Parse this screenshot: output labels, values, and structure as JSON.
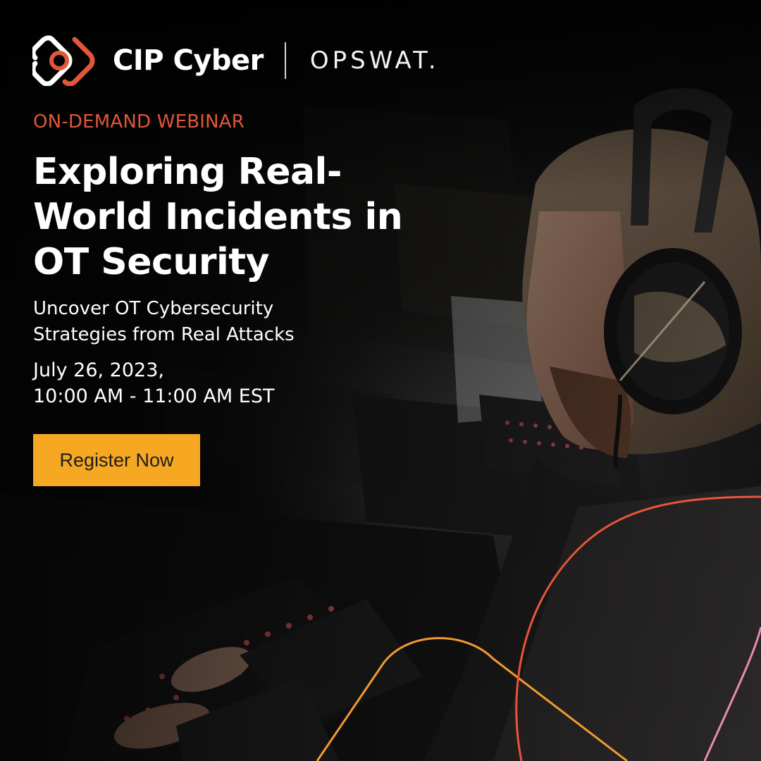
{
  "brand": {
    "primary_name": "CIP Cyber",
    "partner_name": "OPSWAT.",
    "logo_icon": "cip-cyber-logo-icon",
    "accent_color": "#e0573a",
    "logo_ring_color": "#e0573a"
  },
  "webinar": {
    "eyebrow": "ON-DEMAND WEBINAR",
    "title_lines": [
      "Exploring Real-",
      "World Incidents in",
      "OT Security"
    ],
    "subtitle_lines": [
      "Uncover OT Cybersecurity",
      "Strategies from Real Attacks"
    ],
    "date_line": "July 26, 2023,",
    "time_line": "10:00 AM - 11:00 AM EST"
  },
  "cta": {
    "label": "Register Now",
    "background_color": "#f6a823"
  },
  "decor": {
    "orange_line_color": "#f29a2e",
    "red_line_color": "#e8553a",
    "pink_line_color": "#e88ab4"
  }
}
